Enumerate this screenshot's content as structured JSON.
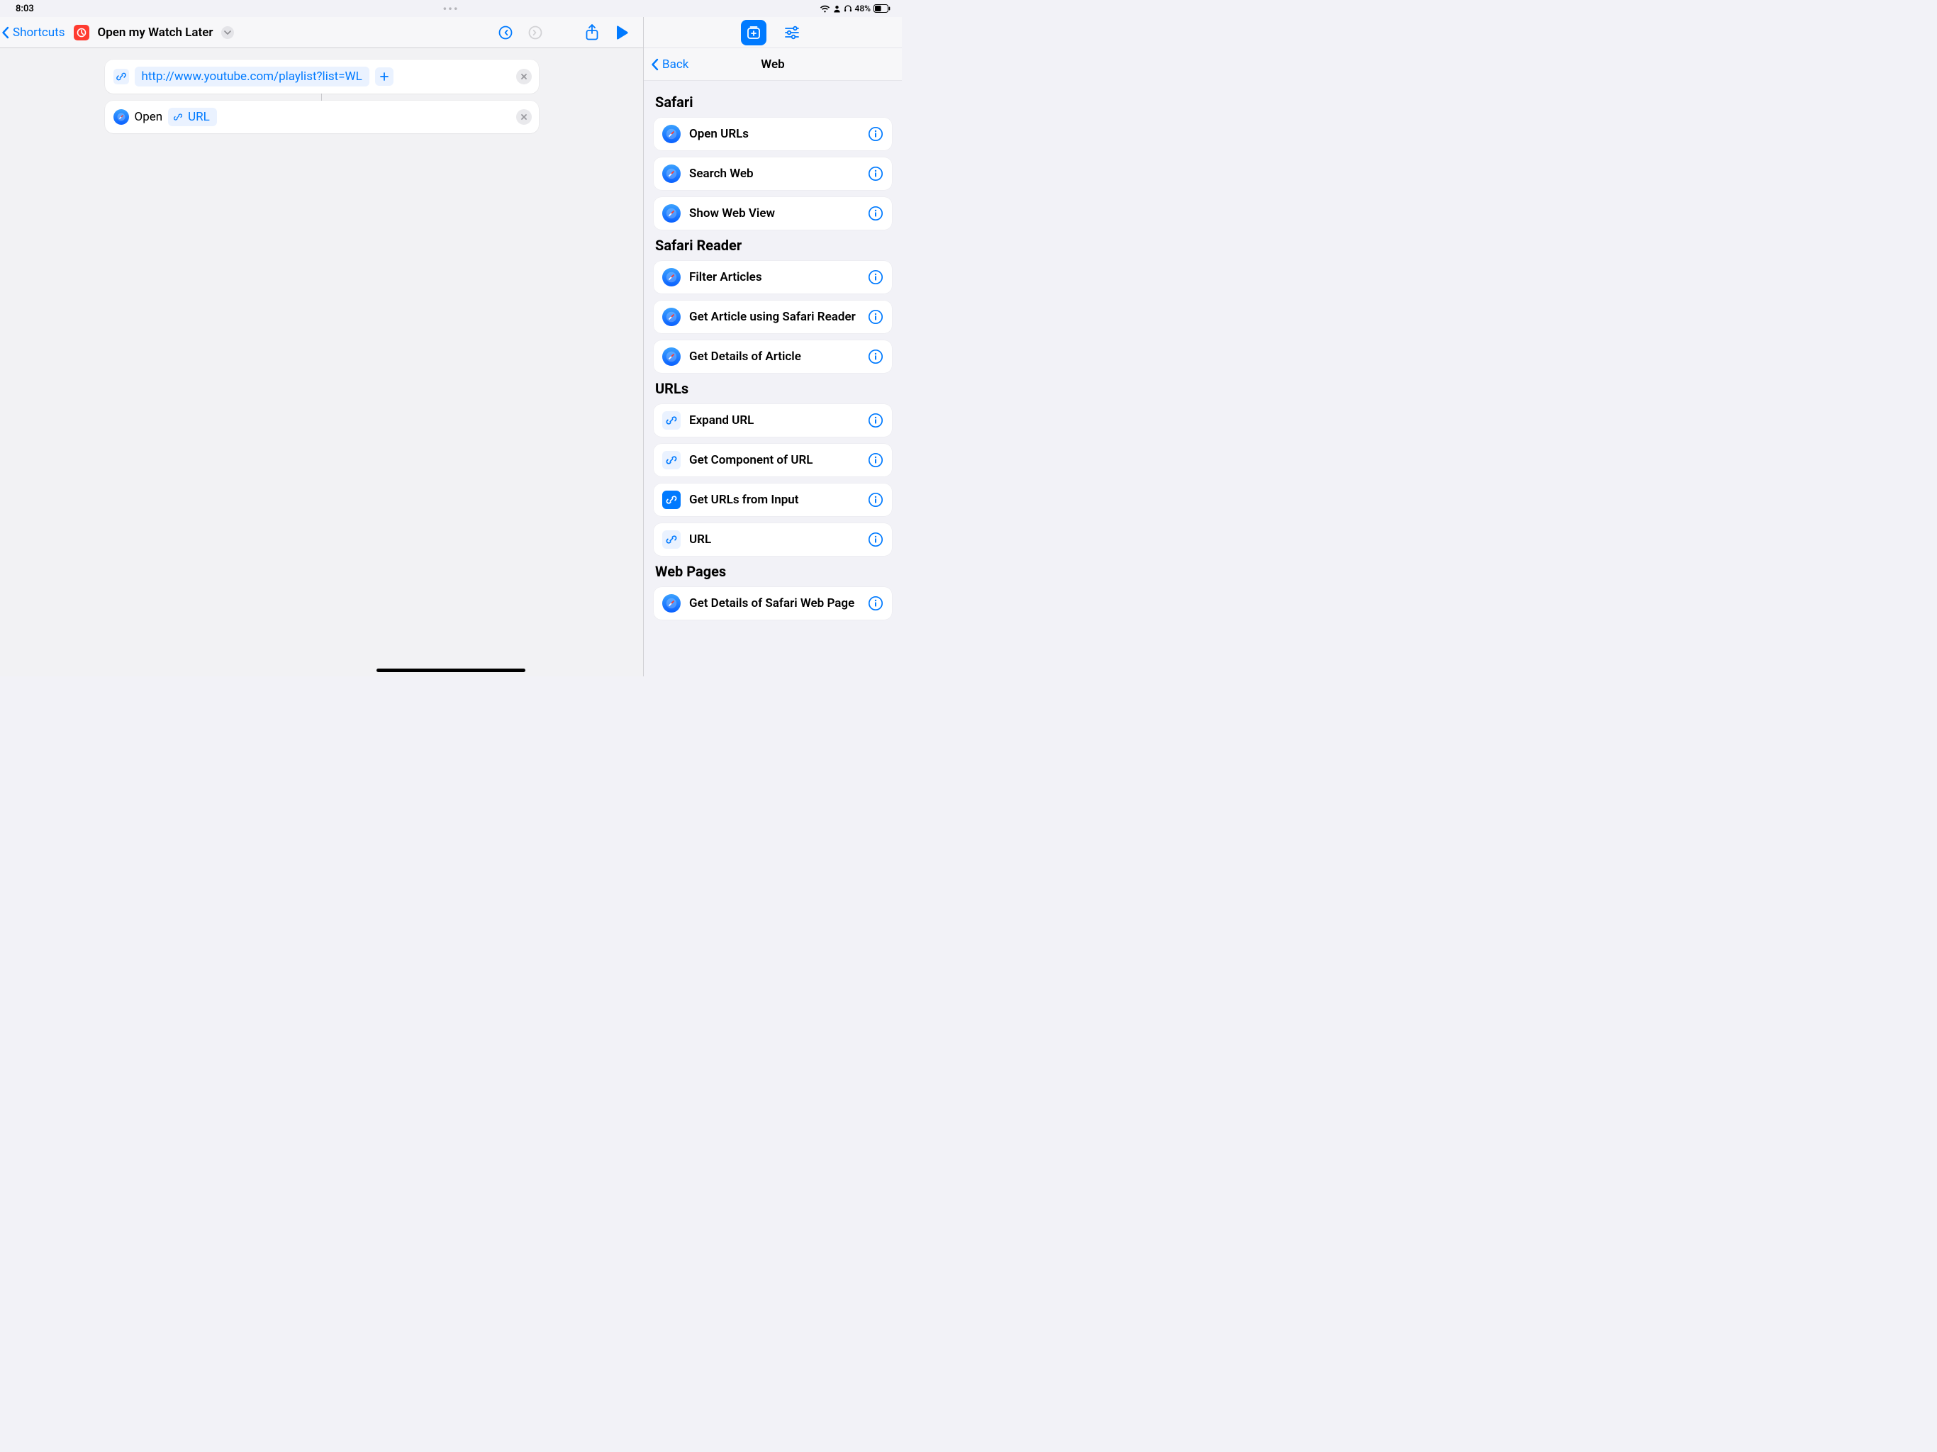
{
  "status": {
    "time": "8:03",
    "battery": "48%"
  },
  "leftToolbar": {
    "back_label": "Shortcuts",
    "shortcut_title": "Open my Watch Later"
  },
  "editor": {
    "urlAction": {
      "url_value": "http://www.youtube.com/playlist?list=WL"
    },
    "openAction": {
      "label": "Open",
      "token": "URL"
    }
  },
  "rightPanel": {
    "nav": {
      "back_label": "Back",
      "title": "Web"
    },
    "sections": [
      {
        "title": "Safari",
        "items": [
          {
            "label": "Open URLs",
            "icon": "safari"
          },
          {
            "label": "Search Web",
            "icon": "safari"
          },
          {
            "label": "Show Web View",
            "icon": "safari"
          }
        ]
      },
      {
        "title": "Safari Reader",
        "items": [
          {
            "label": "Filter Articles",
            "icon": "safari"
          },
          {
            "label": "Get Article using Safari Reader",
            "icon": "safari"
          },
          {
            "label": "Get Details of Article",
            "icon": "safari"
          }
        ]
      },
      {
        "title": "URLs",
        "items": [
          {
            "label": "Expand URL",
            "icon": "box"
          },
          {
            "label": "Get Component of URL",
            "icon": "box"
          },
          {
            "label": "Get URLs from Input",
            "icon": "box-filled"
          },
          {
            "label": "URL",
            "icon": "box"
          }
        ]
      },
      {
        "title": "Web Pages",
        "items": [
          {
            "label": "Get Details of Safari Web Page",
            "icon": "safari"
          }
        ]
      }
    ]
  }
}
